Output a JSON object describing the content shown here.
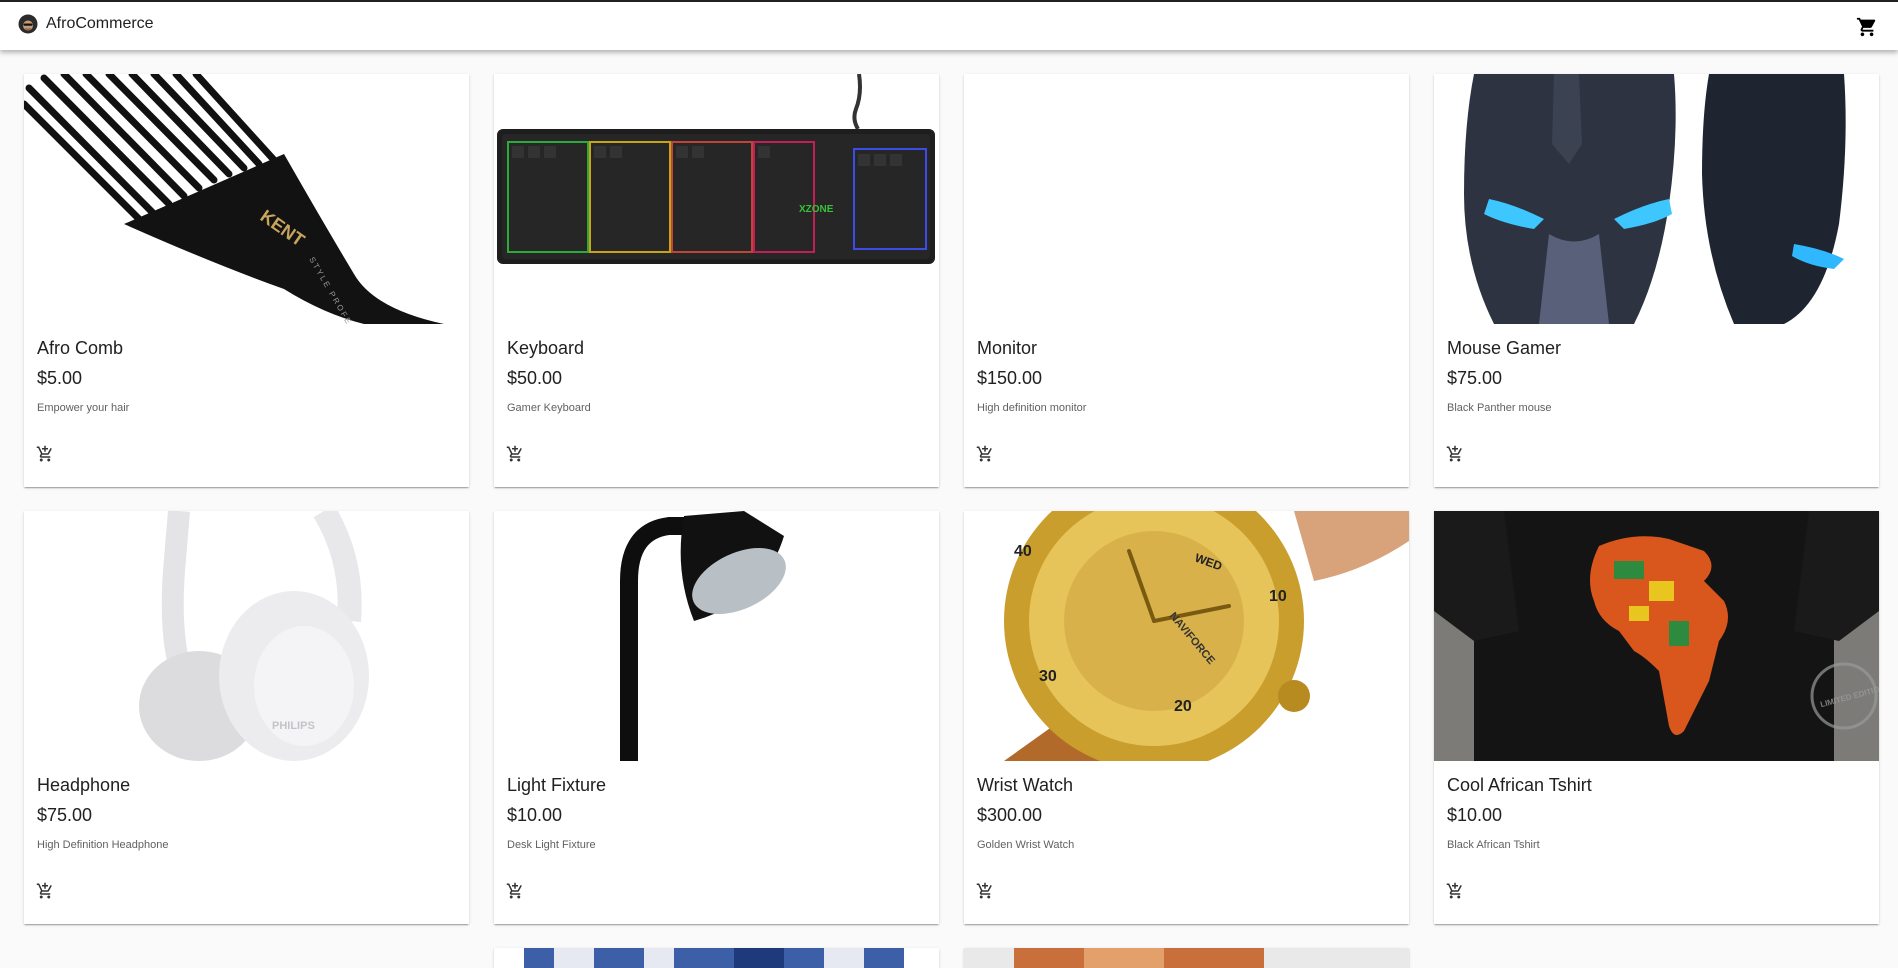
{
  "app": {
    "title": "AfroCommerce"
  },
  "icons": {
    "logo": "afro-face-logo",
    "cart": "shopping-cart-icon",
    "add_to_cart": "add-shopping-cart-icon"
  },
  "products": [
    {
      "name": "Afro Comb",
      "price": "$5.00",
      "description": "Empower your hair",
      "image": "afro-comb-image"
    },
    {
      "name": "Keyboard",
      "price": "$50.00",
      "description": "Gamer Keyboard",
      "image": "keyboard-image"
    },
    {
      "name": "Monitor",
      "price": "$150.00",
      "description": "High definition monitor",
      "image": "monitor-image"
    },
    {
      "name": "Mouse Gamer",
      "price": "$75.00",
      "description": "Black Panther mouse",
      "image": "mouse-image"
    },
    {
      "name": "Headphone",
      "price": "$75.00",
      "description": "High Definition Headphone",
      "image": "headphone-image"
    },
    {
      "name": "Light Fixture",
      "price": "$10.00",
      "description": "Desk Light Fixture",
      "image": "lamp-image"
    },
    {
      "name": "Wrist Watch",
      "price": "$300.00",
      "description": "Golden Wrist Watch",
      "image": "watch-image"
    },
    {
      "name": "Cool African Tshirt",
      "price": "$10.00",
      "description": "Black African Tshirt",
      "image": "tshirt-image"
    }
  ],
  "image_text": {
    "comb_brand": "KENT",
    "comb_sub": "STYLE PROFESSIONAL",
    "keyboard_brand": "XZONE",
    "headphone_brand": "PHILIPS",
    "watch_brand": "NAVIFORCE",
    "watch_day": "WED",
    "watch_n10": "10",
    "watch_n20": "20",
    "watch_n30": "30",
    "watch_n40": "40",
    "tshirt_stamp": "LIMITED EDITION"
  }
}
